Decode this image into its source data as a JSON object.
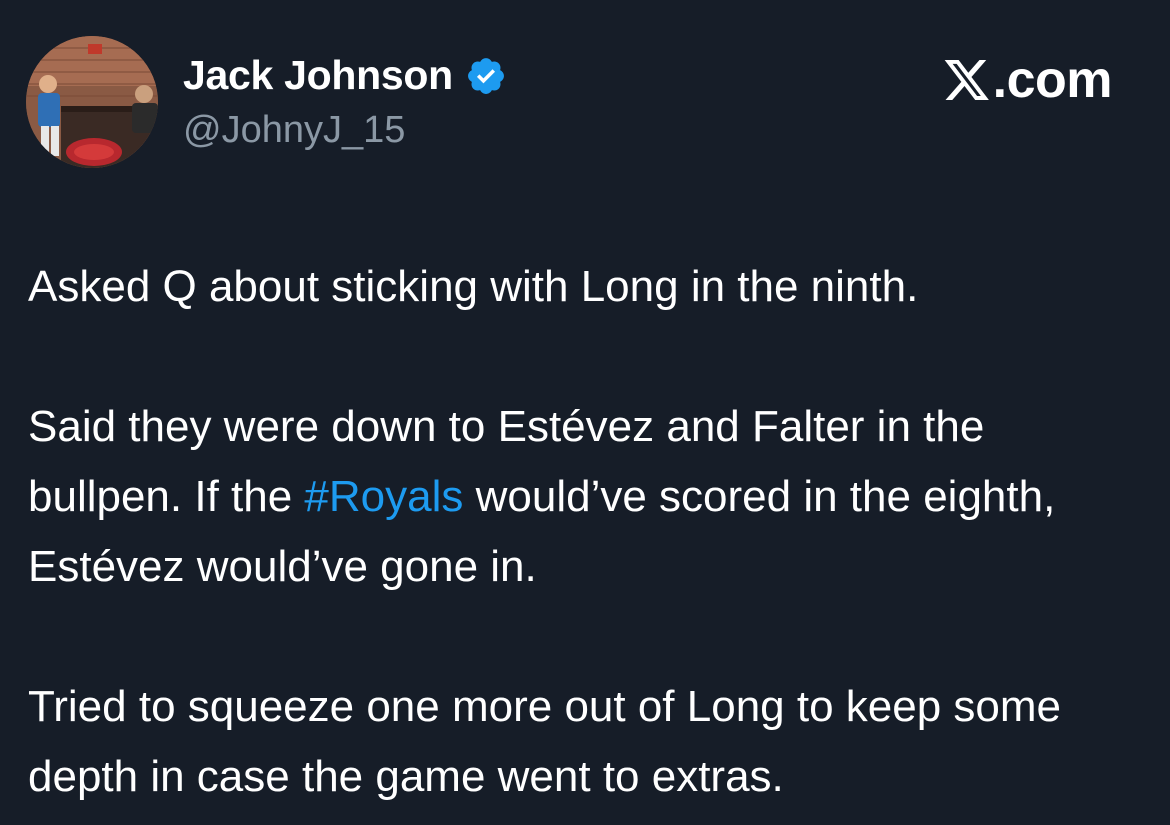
{
  "author": {
    "name": "Jack Johnson",
    "handle": "@JohnyJ_15",
    "verified": true,
    "verified_color": "#1d9bf0",
    "avatar_icon": "profile-photo"
  },
  "brand": {
    "icon": "x-logo-icon",
    "suffix": ".com"
  },
  "tweet": {
    "paragraphs": [
      {
        "text": "Asked Q about sticking with Long in the ninth."
      },
      {
        "before": "Said they were down to Estévez and Falter in the bullpen. If the ",
        "hashtag": "#Royals",
        "after": " would’ve scored in the eighth, Estévez would’ve gone in."
      },
      {
        "text": "Tried to squeeze one more out of Long to keep some depth in case the game went to extras."
      }
    ]
  },
  "colors": {
    "background": "#161d28",
    "text": "#ffffff",
    "secondary_text": "#8b98a5",
    "link": "#1d9bf0"
  }
}
